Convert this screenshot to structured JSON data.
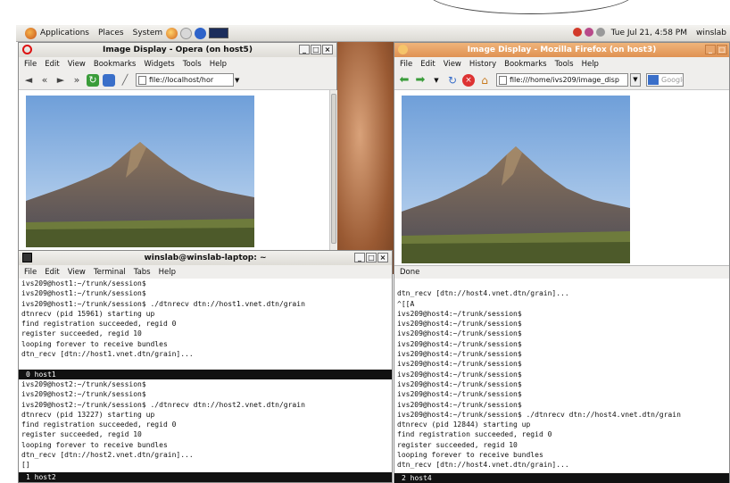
{
  "panel": {
    "applications": "Applications",
    "places": "Places",
    "system": "System",
    "clock": "Tue Jul 21,  4:58 PM",
    "user": "winslab"
  },
  "opera": {
    "title": "Image Display - Opera (on host5)",
    "menu": [
      "File",
      "Edit",
      "View",
      "Bookmarks",
      "Widgets",
      "Tools",
      "Help"
    ],
    "url": "file://localhost/hor"
  },
  "firefox": {
    "title": "Image Display - Mozilla Firefox (on host3)",
    "menu": [
      "File",
      "Edit",
      "View",
      "History",
      "Bookmarks",
      "Tools",
      "Help"
    ],
    "url": "file:///home/ivs209/image_disp",
    "search_placeholder": "Google",
    "status": "Done"
  },
  "terminal1": {
    "title": "winslab@winslab-laptop: ~",
    "menu": [
      "File",
      "Edit",
      "View",
      "Terminal",
      "Tabs",
      "Help"
    ],
    "pane_top_lines": [
      "ivs209@host1:~/trunk/session$",
      "ivs209@host1:~/trunk/session$",
      "ivs209@host1:~/trunk/session$ ./dtnrecv dtn://host1.vnet.dtn/grain",
      "dtnrecv (pid 15961) starting up",
      "find registration succeeded, regid 0",
      "register succeeded, regid 10",
      "looping forever to receive bundles",
      "dtn_recv [dtn://host1.vnet.dtn/grain]..."
    ],
    "pane_top_status": "0 host1",
    "pane_bottom_lines": [
      "ivs209@host2:~/trunk/session$",
      "ivs209@host2:~/trunk/session$",
      "ivs209@host2:~/trunk/session$ ./dtnrecv dtn://host2.vnet.dtn/grain",
      "dtnrecv (pid 13227) starting up",
      "find registration succeeded, regid 0",
      "register succeeded, regid 10",
      "looping forever to receive bundles",
      "dtn_recv [dtn://host2.vnet.dtn/grain]...",
      "[]"
    ],
    "pane_bottom_status": "1 host2"
  },
  "terminal2": {
    "lines": [
      "",
      "dtn_recv [dtn://host4.vnet.dtn/grain]...",
      "^[[A",
      "ivs209@host4:~/trunk/session$",
      "ivs209@host4:~/trunk/session$",
      "ivs209@host4:~/trunk/session$",
      "ivs209@host4:~/trunk/session$",
      "ivs209@host4:~/trunk/session$",
      "ivs209@host4:~/trunk/session$",
      "ivs209@host4:~/trunk/session$",
      "ivs209@host4:~/trunk/session$",
      "ivs209@host4:~/trunk/session$",
      "ivs209@host4:~/trunk/session$",
      "ivs209@host4:~/trunk/session$ ./dtnrecv dtn://host4.vnet.dtn/grain",
      "dtnrecv (pid 12844) starting up",
      "find registration succeeded, regid 0",
      "register succeeded, regid 10",
      "looping forever to receive bundles",
      "dtn_recv [dtn://host4.vnet.dtn/grain]..."
    ],
    "status": "2 host4"
  },
  "colors": {
    "active_titlebar": "#e8a56b",
    "inactive_titlebar": "#e6e4df",
    "terminal_status_bar": "#111111"
  }
}
